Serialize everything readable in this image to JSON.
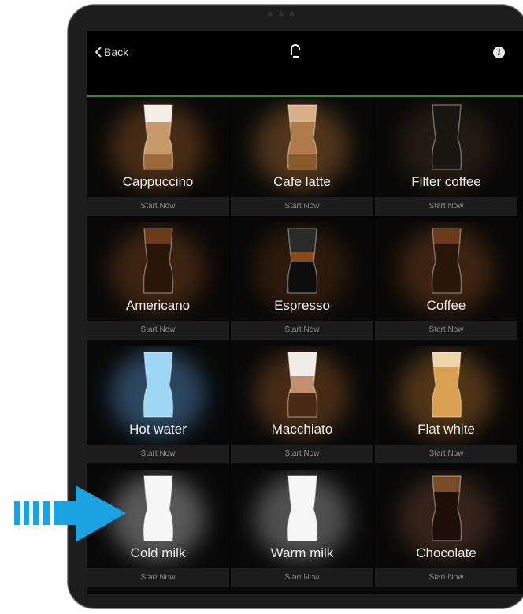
{
  "nav": {
    "back_label": "Back",
    "info_label": "i"
  },
  "colors": {
    "accent_line": "#2f8f2f",
    "arrow": "#1aa3e0"
  },
  "start_label": "Start Now",
  "drinks": [
    {
      "name": "Cappuccino",
      "glow": "#7a4a22",
      "fill": "latte-foam"
    },
    {
      "name": "Cafe latte",
      "glow": "#8a5a2a",
      "fill": "latte"
    },
    {
      "name": "Filter coffee",
      "glow": "#3a2a1a",
      "fill": "dark"
    },
    {
      "name": "Americano",
      "glow": "#6a3a1a",
      "fill": "americano"
    },
    {
      "name": "Espresso",
      "glow": "#4a2a10",
      "fill": "espresso"
    },
    {
      "name": "Coffee",
      "glow": "#6a3a1a",
      "fill": "americano"
    },
    {
      "name": "Hot water",
      "glow": "#4a7aa8",
      "fill": "water"
    },
    {
      "name": "Macchiato",
      "glow": "#7a4a22",
      "fill": "macchiato"
    },
    {
      "name": "Flat white",
      "glow": "#8a5a22",
      "fill": "flatwhite"
    },
    {
      "name": "Cold milk",
      "glow": "#9a9a9a",
      "fill": "milk"
    },
    {
      "name": "Warm milk",
      "glow": "#8a8a8a",
      "fill": "milk"
    },
    {
      "name": "Chocolate",
      "glow": "#5a3a2a",
      "fill": "chocolate"
    }
  ]
}
